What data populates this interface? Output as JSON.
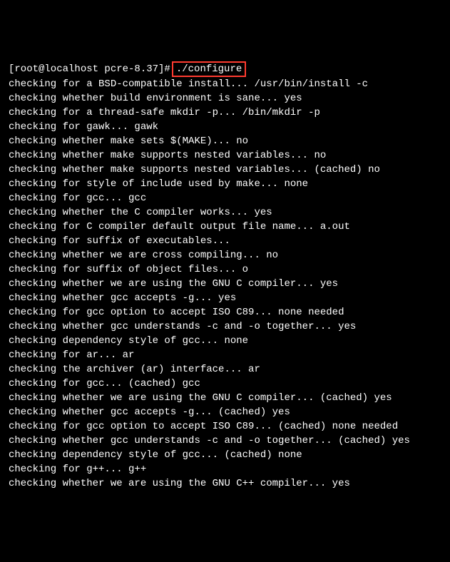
{
  "prompt": {
    "text": "[root@localhost pcre-8.37]#",
    "command": "./configure"
  },
  "lines": [
    "checking for a BSD-compatible install... /usr/bin/install -c",
    "checking whether build environment is sane... yes",
    "checking for a thread-safe mkdir -p... /bin/mkdir -p",
    "checking for gawk... gawk",
    "checking whether make sets $(MAKE)... no",
    "checking whether make supports nested variables... no",
    "checking whether make supports nested variables... (cached) no",
    "checking for style of include used by make... none",
    "checking for gcc... gcc",
    "checking whether the C compiler works... yes",
    "checking for C compiler default output file name... a.out",
    "checking for suffix of executables...",
    "checking whether we are cross compiling... no",
    "checking for suffix of object files... o",
    "checking whether we are using the GNU C compiler... yes",
    "checking whether gcc accepts -g... yes",
    "checking for gcc option to accept ISO C89... none needed",
    "checking whether gcc understands -c and -o together... yes",
    "checking dependency style of gcc... none",
    "checking for ar... ar",
    "checking the archiver (ar) interface... ar",
    "checking for gcc... (cached) gcc",
    "checking whether we are using the GNU C compiler... (cached) yes",
    "checking whether gcc accepts -g... (cached) yes",
    "checking for gcc option to accept ISO C89... (cached) none needed",
    "checking whether gcc understands -c and -o together... (cached) yes",
    "checking dependency style of gcc... (cached) none",
    "checking for g++... g++",
    "checking whether we are using the GNU C++ compiler... yes"
  ]
}
